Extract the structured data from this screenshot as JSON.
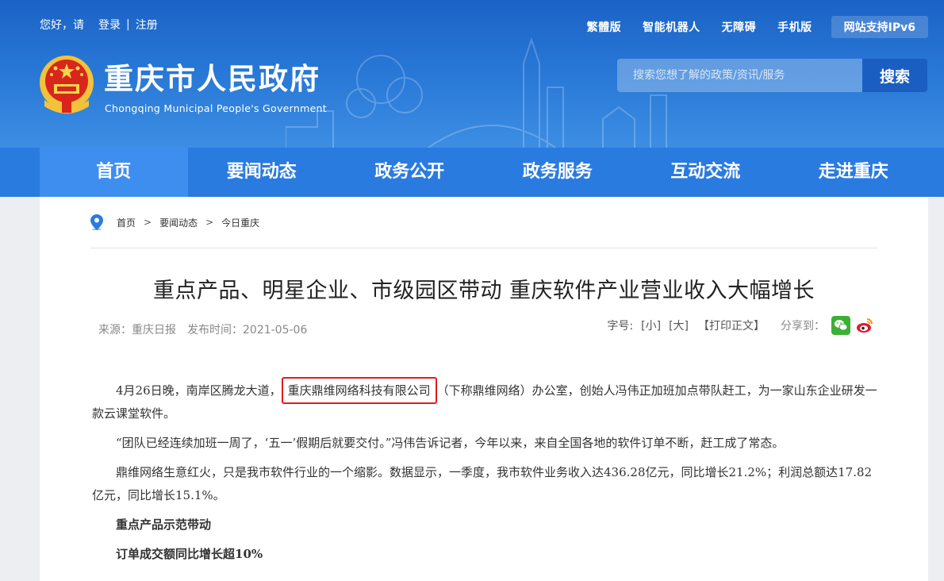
{
  "topbar": {
    "greeting": "您好，请",
    "login": "登录",
    "divider": "|",
    "register": "注册",
    "links": [
      "繁體版",
      "智能机器人",
      "无障碍",
      "手机版"
    ],
    "ipv6": "网站支持IPv6"
  },
  "site": {
    "title": "重庆市人民政府",
    "subtitle": "Chongqing Municipal People's Government"
  },
  "search": {
    "placeholder": "搜索您想了解的政策/资讯/服务",
    "button": "搜索"
  },
  "nav": {
    "items": [
      "首页",
      "要闻动态",
      "政务公开",
      "政务服务",
      "互动交流",
      "走进重庆"
    ],
    "active_index": 0
  },
  "breadcrumb": {
    "items": [
      "首页",
      "要闻动态",
      "今日重庆"
    ],
    "separator": ">"
  },
  "article": {
    "title": "重点产品、明星企业、市级园区带动 重庆软件产业营业收入大幅增长",
    "source": "来源：重庆日报",
    "date": "发布时间：2021-05-06",
    "font_label": "字号:",
    "font_small": "[小]",
    "font_large": "[大]",
    "print": "【打印正文】",
    "share_label": "分享到：",
    "p1_before": "4月26日晚，南岸区腾龙大道，",
    "p1_highlight": "重庆鼎维网络科技有限公司",
    "p1_after": "（下称鼎维网络）办公室，创始人冯伟正加班加点带队赶工，为一家山东企业研发一款云课堂软件。",
    "p2": "“团队已经连续加班一周了，‘五一’假期后就要交付。”冯伟告诉记者，今年以来，来自全国各地的软件订单不断，赶工成了常态。",
    "p3": "鼎维网络生意红火，只是我市软件行业的一个缩影。数据显示，一季度，我市软件业务收入达436.28亿元，同比增长21.2%；利润总额达17.82亿元，同比增长15.1%。",
    "h1": "重点产品示范带动",
    "h2": "订单成交额同比增长超10%"
  },
  "colors": {
    "header_blue": "#1b63c6",
    "nav_blue": "#2a7be0",
    "highlight_red": "#e21c1c"
  },
  "icons": [
    "emblem-icon",
    "location-pin-icon",
    "wechat-icon",
    "weibo-icon"
  ]
}
